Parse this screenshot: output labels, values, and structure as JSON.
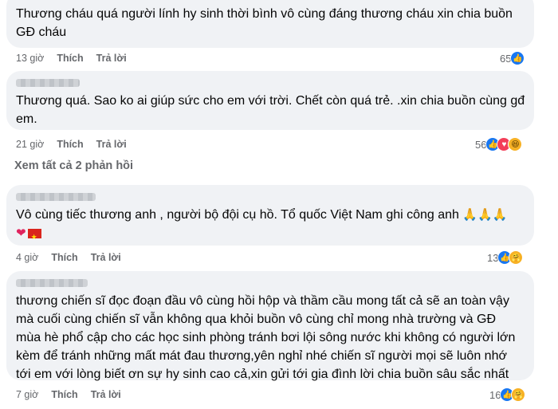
{
  "comments": [
    {
      "text": "Thương cháu quá người lính hy sinh thời bình vô cùng đáng thương cháu xin chia buồn GĐ cháu",
      "time": "13 giờ",
      "like_label": "Thích",
      "reply_label": "Trả lời",
      "reaction_count": "65",
      "reaction_icons": [
        "like-icon"
      ]
    },
    {
      "text": "Thương quá. Sao ko ai giúp sức cho em với trời. Chết còn quá trẻ. .xin chia buồn cùng gđ em.",
      "time": "21 giờ",
      "like_label": "Thích",
      "reply_label": "Trả lời",
      "reaction_count": "56",
      "reaction_icons": [
        "like-icon",
        "love-icon",
        "haha-icon"
      ]
    },
    {
      "text": "Vô cùng tiếc thương anh , người bộ đội cụ hồ. Tổ quốc Việt Nam ghi công anh",
      "time": "4 giờ",
      "like_label": "Thích",
      "reply_label": "Trả lời",
      "reaction_count": "13",
      "reaction_icons": [
        "like-icon",
        "care-icon"
      ]
    },
    {
      "text": "thương chiến sĩ đọc đoạn đầu vô cùng hồi hộp và thầm cầu mong tất cả sẽ an toàn vậy mà cuối cùng chiến sĩ vẫn không qua khỏi buồn vô cùng chỉ mong nhà trường và GĐ mùa hè phổ cập cho các học sinh phòng tránh bơi lội sông nước khi không có người lớn kèm để tránh những mất mát đau thương,yên nghỉ nhé chiến sĩ người mọi sẽ luôn nhớ tới em với lòng biết ơn sự hy sinh cao cả,xin gửi tới gia đình lời chia buồn sâu sắc nhất",
      "time": "7 giờ",
      "like_label": "Thích",
      "reply_label": "Trả lời",
      "reaction_count": "16",
      "reaction_icons": [
        "like-icon",
        "care-icon"
      ]
    }
  ],
  "view_all_replies": "Xem tất cả 2 phản hồi",
  "colors": {
    "bubble_bg": "#f0f2f5",
    "meta_text": "#65676b",
    "like_blue": "#1877f2",
    "love_red": "#f33e58",
    "care_yellow": "#f7b125"
  }
}
